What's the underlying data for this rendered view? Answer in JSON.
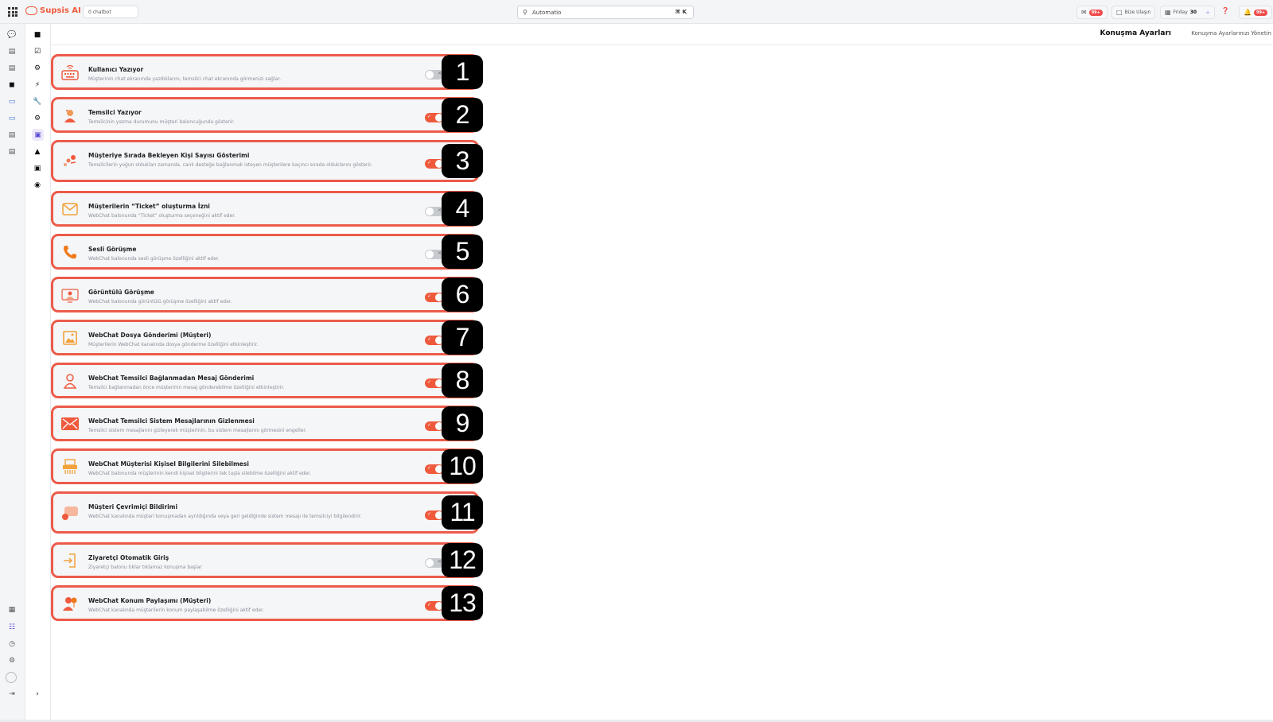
{
  "topbar": {
    "brand": "Supsis AI",
    "chatbot_pill": "0 chatbot",
    "search_value": "Automatio",
    "search_shortcut": "⌘ K",
    "mail_badge": "99+",
    "contact_label": "Bize Ulaşın",
    "date_label": "Friday",
    "date_day": "30",
    "notif_badge": "99+"
  },
  "header": {
    "title": "Konuşma Ayarları",
    "subtitle": "Konuşma Ayarlarınızı Yönetin"
  },
  "settings": [
    {
      "num": "1",
      "title": "Kullanıcı Yazıyor",
      "desc": "Müşterinin chat ekranında yazdıklarını, temsilci chat ekranında görmenizi sağlar.",
      "on": false,
      "icon": "keyboard-icon"
    },
    {
      "num": "2",
      "title": "Temsilci Yazıyor",
      "desc": "Temsilcinin yazma durumunu müşteri baloncuğunda gösterir.",
      "on": true,
      "icon": "agent-typing-icon"
    },
    {
      "num": "3",
      "title": "Müşteriye Sırada Bekleyen Kişi Sayısı Gösterimi",
      "desc": "Temsilcilerin yoğun oldukları zamanda, canlı desteğe bağlanmak isteyen müşterilere kaçıncı sırada olduklarını gösterir.",
      "on": true,
      "icon": "queue-icon"
    },
    {
      "num": "4",
      "title": "Müşterilerin “Ticket” oluşturma İzni",
      "desc": "WebChat balonunda “Ticket” oluşturma seçeneğini aktif eder.",
      "on": false,
      "icon": "envelope-icon"
    },
    {
      "num": "5",
      "title": "Sesli Görüşme",
      "desc": "WebChat balonunda sesli görüşme özelliğini aktif eder.",
      "on": false,
      "icon": "phone-icon"
    },
    {
      "num": "6",
      "title": "Görüntülü Görüşme",
      "desc": "WebChat balonunda görüntülü görüşme özelliğini aktif eder.",
      "on": true,
      "icon": "video-call-icon"
    },
    {
      "num": "7",
      "title": "WebChat Dosya Gönderimi (Müşteri)",
      "desc": "Müşterilerin WebChat kanalında dosya gönderme özelliğini etkinleştirir.",
      "on": true,
      "icon": "image-file-icon"
    },
    {
      "num": "8",
      "title": "WebChat Temsilci Bağlanmadan Mesaj Gönderimi",
      "desc": "Temsilci bağlanmadan önce müşterinin mesaj gönderebilme özelliğini etkinleştirir.",
      "on": true,
      "icon": "person-icon"
    },
    {
      "num": "9",
      "title": "WebChat Temsilci Sistem Mesajlarının Gizlenmesi",
      "desc": "Temsilci sistem mesajlarını gizleyerek müşterinin, bu sistem mesajlarını görmesini engeller.",
      "on": true,
      "icon": "hidden-mail-icon"
    },
    {
      "num": "10",
      "title": "WebChat Müşterisi Kişisel Bilgilerini Silebilmesi",
      "desc": "WebChat balonunda müşterinin kendi kişisel bilgilerini tek tuşla silebilme özelliğini aktif eder.",
      "on": true,
      "icon": "shredder-icon"
    },
    {
      "num": "11",
      "title": "Müşteri Çevrimiçi Bildirimi",
      "desc": "WebChat kanalında müşteri konuşmadan ayrıldığında veya geri geldiğinde sistem mesajı ile temsilciyi bilgilendirir.",
      "on": true,
      "icon": "chat-notify-icon"
    },
    {
      "num": "12",
      "title": "Ziyaretçi Otomatik Giriş",
      "desc": "Ziyaretçi balonu tıklar tıklamaz konuşma başlar",
      "on": false,
      "icon": "login-icon"
    },
    {
      "num": "13",
      "title": "WebChat Konum Paylaşımı (Müşteri)",
      "desc": "WebChat kanalında müşterilerin konum paylaşabilme özelliğini aktif eder.",
      "on": true,
      "icon": "location-person-icon"
    }
  ],
  "colors": {
    "accent": "#ef5a3d",
    "card_border": "#ec5b4a",
    "toggle_off": "#c6c9ce"
  }
}
